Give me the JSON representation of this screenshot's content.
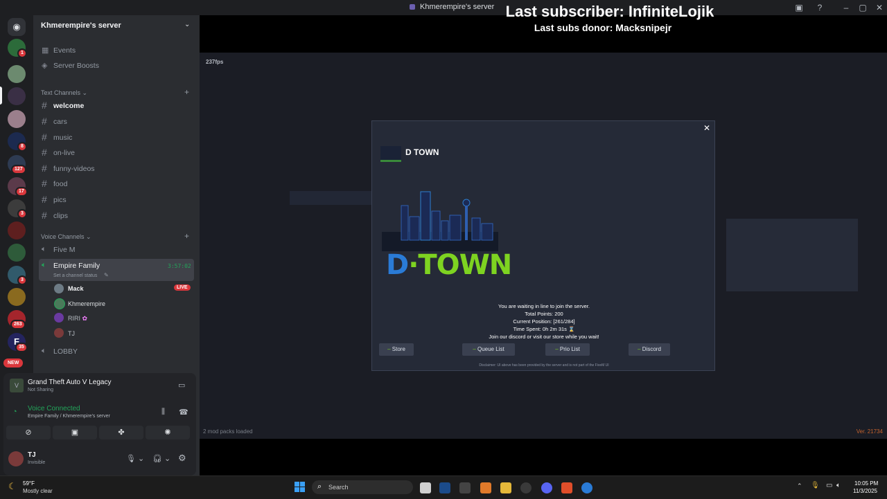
{
  "window": {
    "title": "Khmerempire's server"
  },
  "overlay": {
    "last_subscriber": "Last subscriber: InfiniteLojik",
    "last_donor": "Last subs donor: Macksnipejr"
  },
  "servers": [
    {
      "badge": "1"
    },
    {
      "badge": ""
    },
    {
      "badge": ""
    },
    {
      "badge": ""
    },
    {
      "badge": "8"
    },
    {
      "badge": "127"
    },
    {
      "badge": "17"
    },
    {
      "badge": "3"
    },
    {
      "badge": ""
    },
    {
      "badge": ""
    },
    {
      "badge": "3"
    },
    {
      "badge": ""
    },
    {
      "badge": "263"
    },
    {
      "badge": "35"
    }
  ],
  "new_badge": "NEW",
  "sidebar": {
    "server_name": "Khmerempire's server",
    "top_items": [
      "Events",
      "Server Boosts"
    ],
    "text_category": "Text Channels",
    "text_channels": [
      "welcome",
      "cars",
      "music",
      "on-live",
      "funny-videos",
      "food",
      "pics",
      "clips"
    ],
    "voice_category": "Voice Channels",
    "voice_channels": {
      "fivem": "Five M",
      "empire": "Empire Family",
      "empire_timer": "3:57:02",
      "empire_status": "Set a channel status",
      "users": [
        "Mack",
        "Khmerempire",
        "RIRI",
        "TJ"
      ],
      "live": "LIVE",
      "lobby": "LOBBY"
    }
  },
  "activity": {
    "game": "Grand Theft Auto V Legacy",
    "game_sub": "Not Sharing",
    "voice_status": "Voice Connected",
    "voice_channel": "Empire Family / Khmerempire's server",
    "user_name": "TJ",
    "user_status": "Invisible"
  },
  "game": {
    "fps": "237fps",
    "modpacks": "2 mod packs loaded",
    "version": "Ver. 21734"
  },
  "modal": {
    "title": "D TOWN",
    "logo_text": "D·TOWN",
    "messages": [
      "You are waiting in line to join the server.",
      "Total Points: 200",
      "Current Position: [261/284]",
      "Time Spent: 0h 2m 31s ⌛",
      "Join our discord or visit our store while you wait!"
    ],
    "buttons": [
      "Store",
      "Queue List",
      "Prio List",
      "Discord"
    ],
    "disclaimer": "Disclaimer: UI above has been provided by the server and is not part of the FiveM UI"
  },
  "taskbar": {
    "weather_temp": "59°F",
    "weather_desc": "Mostly clear",
    "search": "Search",
    "time": "10:05 PM",
    "date": "11/3/2025"
  },
  "colors": {
    "accent": "#23a55a",
    "danger": "#da373c",
    "brand_blue": "#2a7bd6",
    "brand_green": "#7ed321"
  }
}
